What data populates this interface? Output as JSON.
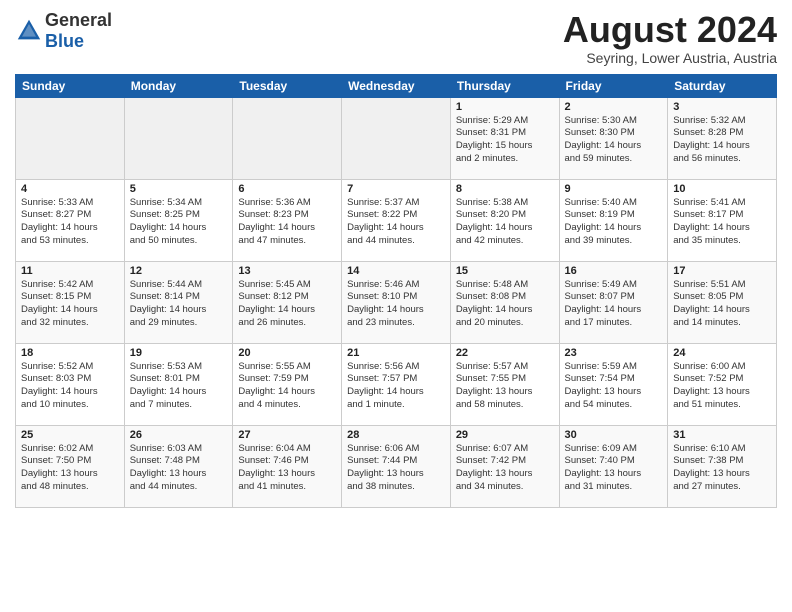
{
  "logo": {
    "general": "General",
    "blue": "Blue"
  },
  "title": {
    "month_year": "August 2024",
    "location": "Seyring, Lower Austria, Austria"
  },
  "days_of_week": [
    "Sunday",
    "Monday",
    "Tuesday",
    "Wednesday",
    "Thursday",
    "Friday",
    "Saturday"
  ],
  "weeks": [
    [
      {
        "day": "",
        "info": ""
      },
      {
        "day": "",
        "info": ""
      },
      {
        "day": "",
        "info": ""
      },
      {
        "day": "",
        "info": ""
      },
      {
        "day": "1",
        "info": "Sunrise: 5:29 AM\nSunset: 8:31 PM\nDaylight: 15 hours\nand 2 minutes."
      },
      {
        "day": "2",
        "info": "Sunrise: 5:30 AM\nSunset: 8:30 PM\nDaylight: 14 hours\nand 59 minutes."
      },
      {
        "day": "3",
        "info": "Sunrise: 5:32 AM\nSunset: 8:28 PM\nDaylight: 14 hours\nand 56 minutes."
      }
    ],
    [
      {
        "day": "4",
        "info": "Sunrise: 5:33 AM\nSunset: 8:27 PM\nDaylight: 14 hours\nand 53 minutes."
      },
      {
        "day": "5",
        "info": "Sunrise: 5:34 AM\nSunset: 8:25 PM\nDaylight: 14 hours\nand 50 minutes."
      },
      {
        "day": "6",
        "info": "Sunrise: 5:36 AM\nSunset: 8:23 PM\nDaylight: 14 hours\nand 47 minutes."
      },
      {
        "day": "7",
        "info": "Sunrise: 5:37 AM\nSunset: 8:22 PM\nDaylight: 14 hours\nand 44 minutes."
      },
      {
        "day": "8",
        "info": "Sunrise: 5:38 AM\nSunset: 8:20 PM\nDaylight: 14 hours\nand 42 minutes."
      },
      {
        "day": "9",
        "info": "Sunrise: 5:40 AM\nSunset: 8:19 PM\nDaylight: 14 hours\nand 39 minutes."
      },
      {
        "day": "10",
        "info": "Sunrise: 5:41 AM\nSunset: 8:17 PM\nDaylight: 14 hours\nand 35 minutes."
      }
    ],
    [
      {
        "day": "11",
        "info": "Sunrise: 5:42 AM\nSunset: 8:15 PM\nDaylight: 14 hours\nand 32 minutes."
      },
      {
        "day": "12",
        "info": "Sunrise: 5:44 AM\nSunset: 8:14 PM\nDaylight: 14 hours\nand 29 minutes."
      },
      {
        "day": "13",
        "info": "Sunrise: 5:45 AM\nSunset: 8:12 PM\nDaylight: 14 hours\nand 26 minutes."
      },
      {
        "day": "14",
        "info": "Sunrise: 5:46 AM\nSunset: 8:10 PM\nDaylight: 14 hours\nand 23 minutes."
      },
      {
        "day": "15",
        "info": "Sunrise: 5:48 AM\nSunset: 8:08 PM\nDaylight: 14 hours\nand 20 minutes."
      },
      {
        "day": "16",
        "info": "Sunrise: 5:49 AM\nSunset: 8:07 PM\nDaylight: 14 hours\nand 17 minutes."
      },
      {
        "day": "17",
        "info": "Sunrise: 5:51 AM\nSunset: 8:05 PM\nDaylight: 14 hours\nand 14 minutes."
      }
    ],
    [
      {
        "day": "18",
        "info": "Sunrise: 5:52 AM\nSunset: 8:03 PM\nDaylight: 14 hours\nand 10 minutes."
      },
      {
        "day": "19",
        "info": "Sunrise: 5:53 AM\nSunset: 8:01 PM\nDaylight: 14 hours\nand 7 minutes."
      },
      {
        "day": "20",
        "info": "Sunrise: 5:55 AM\nSunset: 7:59 PM\nDaylight: 14 hours\nand 4 minutes."
      },
      {
        "day": "21",
        "info": "Sunrise: 5:56 AM\nSunset: 7:57 PM\nDaylight: 14 hours\nand 1 minute."
      },
      {
        "day": "22",
        "info": "Sunrise: 5:57 AM\nSunset: 7:55 PM\nDaylight: 13 hours\nand 58 minutes."
      },
      {
        "day": "23",
        "info": "Sunrise: 5:59 AM\nSunset: 7:54 PM\nDaylight: 13 hours\nand 54 minutes."
      },
      {
        "day": "24",
        "info": "Sunrise: 6:00 AM\nSunset: 7:52 PM\nDaylight: 13 hours\nand 51 minutes."
      }
    ],
    [
      {
        "day": "25",
        "info": "Sunrise: 6:02 AM\nSunset: 7:50 PM\nDaylight: 13 hours\nand 48 minutes."
      },
      {
        "day": "26",
        "info": "Sunrise: 6:03 AM\nSunset: 7:48 PM\nDaylight: 13 hours\nand 44 minutes."
      },
      {
        "day": "27",
        "info": "Sunrise: 6:04 AM\nSunset: 7:46 PM\nDaylight: 13 hours\nand 41 minutes."
      },
      {
        "day": "28",
        "info": "Sunrise: 6:06 AM\nSunset: 7:44 PM\nDaylight: 13 hours\nand 38 minutes."
      },
      {
        "day": "29",
        "info": "Sunrise: 6:07 AM\nSunset: 7:42 PM\nDaylight: 13 hours\nand 34 minutes."
      },
      {
        "day": "30",
        "info": "Sunrise: 6:09 AM\nSunset: 7:40 PM\nDaylight: 13 hours\nand 31 minutes."
      },
      {
        "day": "31",
        "info": "Sunrise: 6:10 AM\nSunset: 7:38 PM\nDaylight: 13 hours\nand 27 minutes."
      }
    ]
  ]
}
